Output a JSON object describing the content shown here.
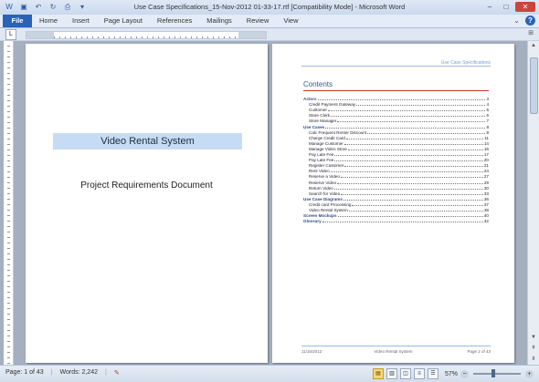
{
  "window": {
    "title": "Use Case Specifications_15-Nov-2012 01-33-17.rtf [Compatibility Mode] - Microsoft Word"
  },
  "ribbon": {
    "file_label": "File",
    "tabs": [
      "Home",
      "Insert",
      "Page Layout",
      "References",
      "Mailings",
      "Review",
      "View"
    ]
  },
  "page1": {
    "title": "Video Rental System",
    "subtitle": "Project Requirements Document"
  },
  "page2": {
    "header": "Use Case Specifications",
    "toc_title": "Contents",
    "toc": [
      {
        "label": "Actors",
        "page": "3",
        "level": 1
      },
      {
        "label": "Credit Payment Gateway",
        "page": "4",
        "level": 2
      },
      {
        "label": "Customer",
        "page": "5",
        "level": 2
      },
      {
        "label": "Store Clerk",
        "page": "6",
        "level": 2
      },
      {
        "label": "Store Manager",
        "page": "7",
        "level": 2
      },
      {
        "label": "Use Cases",
        "page": "8",
        "level": 1
      },
      {
        "label": "Calc Frequent Renter Discount",
        "page": "9",
        "level": 2
      },
      {
        "label": "Charge Credit Card",
        "page": "11",
        "level": 2
      },
      {
        "label": "Manage Customer",
        "page": "14",
        "level": 2
      },
      {
        "label": "Manage Video Store",
        "page": "16",
        "level": 2
      },
      {
        "label": "Pay Late Fee",
        "page": "17",
        "level": 2
      },
      {
        "label": "Pay Late Fee",
        "page": "20",
        "level": 2
      },
      {
        "label": "Register Customer",
        "page": "21",
        "level": 2
      },
      {
        "label": "Rent Video",
        "page": "24",
        "level": 2
      },
      {
        "label": "Reserve a Video",
        "page": "27",
        "level": 2
      },
      {
        "label": "Reserve Video",
        "page": "29",
        "level": 2
      },
      {
        "label": "Return Video",
        "page": "30",
        "level": 2
      },
      {
        "label": "Search for Video",
        "page": "33",
        "level": 2
      },
      {
        "label": "Use Case Diagrams",
        "page": "36",
        "level": 1
      },
      {
        "label": "Credit card Processing",
        "page": "37",
        "level": 2
      },
      {
        "label": "Video Rental System",
        "page": "38",
        "level": 2
      },
      {
        "label": "Screen Mockups",
        "page": "40",
        "level": 1
      },
      {
        "label": "Glossary",
        "page": "42",
        "level": 1
      }
    ],
    "footer_left": "11/15/2012",
    "footer_center": "Video Rental System",
    "footer_right": "Page 2 of 43"
  },
  "status": {
    "page": "Page: 1 of 43",
    "words": "Words: 2,242",
    "zoom": "57%"
  }
}
